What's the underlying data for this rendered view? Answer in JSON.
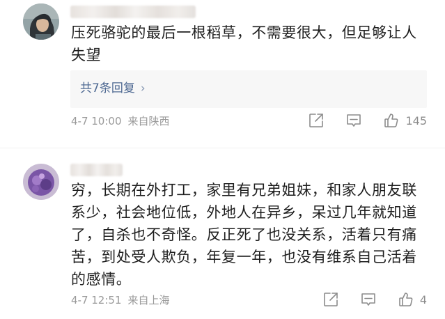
{
  "comments": [
    {
      "text": "压死骆驼的最后一根稻草，不需要很大，但足够让人失望",
      "replies_label": "共7条回复",
      "replies_chevron": "›",
      "date": "4-7 10:00",
      "location": "来自陕西",
      "likes": "145",
      "icons": [
        "share-icon",
        "comment-icon",
        "like-icon"
      ]
    },
    {
      "text": "穷，长期在外打工，家里有兄弟姐妹，和家人朋友联系少，社会地位低，外地人在异乡，呆过几年就知道了，自杀也不奇怪。反正死了也没关系，活着只有痛苦，到处受人欺负，年复一年，也没有维系自己活着的感情。",
      "date": "4-7 12:51",
      "location": "来自上海",
      "likes": "4",
      "icons": [
        "share-icon",
        "comment-icon",
        "like-icon"
      ]
    }
  ]
}
